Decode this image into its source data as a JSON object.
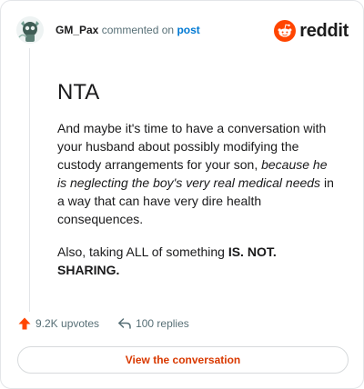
{
  "header": {
    "author": "GM_Pax",
    "action_text": "commented on",
    "post_link": "post",
    "brand_name": "reddit"
  },
  "comment": {
    "title": "NTA",
    "para1_part1": "And maybe it's time to have a conversation with your husband about possibly modifying the custody arrangements for your son, ",
    "para1_italic": "because he is neglecting the boy's very real medical needs",
    "para1_part2": " in a way that can have very dire health consequences.",
    "para2_part1": "Also, taking ALL of something ",
    "para2_bold": "IS. NOT. SHARING."
  },
  "footer": {
    "upvotes": "9.2K upvotes",
    "replies": "100 replies"
  },
  "cta": {
    "label": "View the conversation"
  },
  "colors": {
    "brand": "#ff4500",
    "upvote": "#ff4500",
    "cta_text": "#d93900",
    "link": "#0079d3",
    "muted": "#576f76"
  },
  "icons": {
    "avatar": "avatar-icon",
    "brand_logo": "reddit-logo-icon",
    "upvote": "upvote-arrow-icon",
    "reply": "reply-arrow-icon"
  }
}
